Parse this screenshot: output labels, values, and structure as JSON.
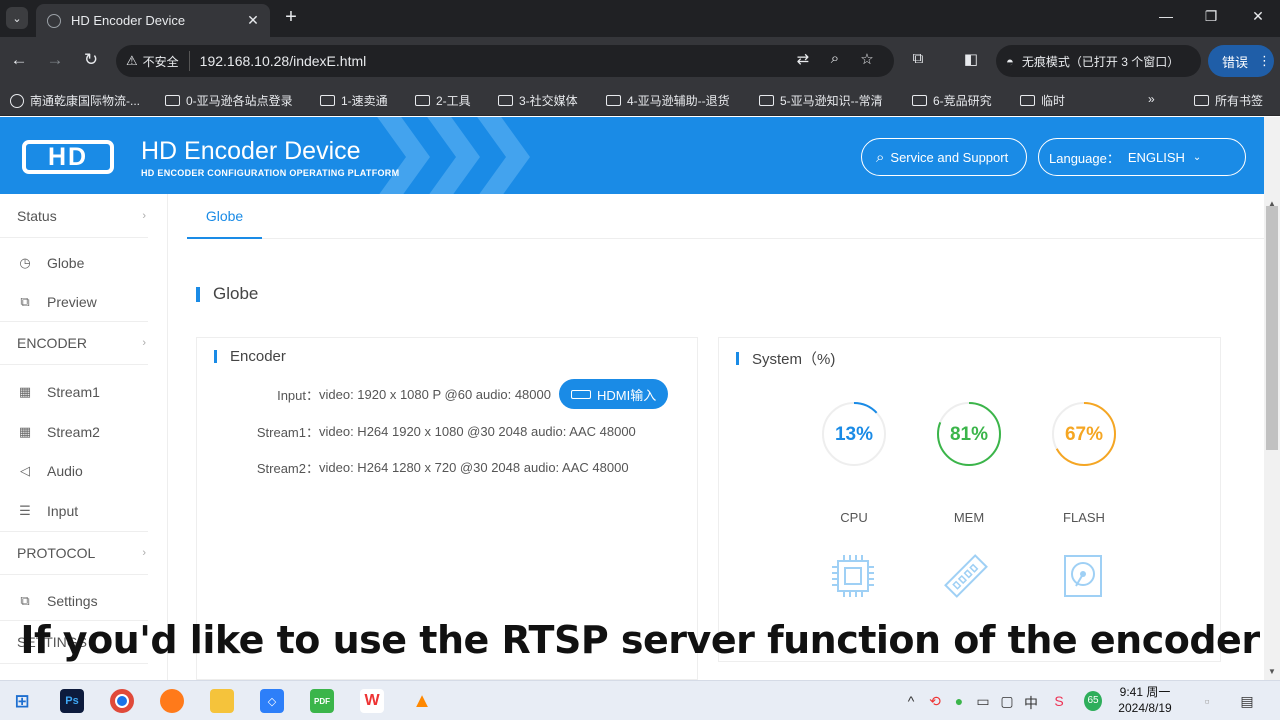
{
  "browser": {
    "tab_title": "HD Encoder Device",
    "insecure_label": "不安全",
    "url": "192.168.10.28/indexE.html",
    "incognito_label": "无痕模式（已打开 3 个窗口）",
    "error_label": "错误",
    "bookmarks": [
      "南通乾康国际物流-...",
      "0-亚马逊各站点登录",
      "1-速卖通",
      "2-工具",
      "3-社交媒体",
      "4-亚马逊辅助--退货",
      "5-亚马逊知识--常清",
      "6-竞品研究",
      "临时"
    ],
    "all_bookmarks": "所有书签"
  },
  "header": {
    "logo_text": "HD",
    "title": "HD Encoder Device",
    "subtitle": "HD ENCODER CONFIGURATION OPERATING PLATFORM",
    "service_label": "Service and Support",
    "language_label": "Language：",
    "language_value": "ENGLISH"
  },
  "sidebar": {
    "status": "Status",
    "globe": "Globe",
    "preview": "Preview",
    "encoder": "ENCODER",
    "stream1": "Stream1",
    "stream2": "Stream2",
    "audio": "Audio",
    "input": "Input",
    "protocol": "PROTOCOL",
    "settings": "Settings",
    "settings_section": "SETTINGS"
  },
  "main": {
    "tab_label": "Globe",
    "section_title": "Globe",
    "encoder_panel": {
      "title": "Encoder",
      "rows": [
        {
          "label": "Input：",
          "value": "video: 1920 x 1080 P @60 audio: 48000"
        },
        {
          "label": "Stream1：",
          "value": "video: H264 1920 x 1080 @30 2048 audio: AAC 48000"
        },
        {
          "label": "Stream2：",
          "value": "video: H264 1280 x 720 @30 2048 audio: AAC 48000"
        }
      ],
      "input_badge": "HDMI输入"
    },
    "system_panel": {
      "title": "System（%)",
      "gauges": [
        {
          "name": "CPU",
          "value": 13,
          "display": "13%",
          "color": "#1a8be6"
        },
        {
          "name": "MEM",
          "value": 81,
          "display": "81%",
          "color": "#3bb54a"
        },
        {
          "name": "FLASH",
          "value": 67,
          "display": "67%",
          "color": "#f5a623"
        }
      ]
    }
  },
  "caption": "If you'd like to use the RTSP server function of the encoder",
  "taskbar": {
    "time": "9:41 周一",
    "date": "2024/8/19",
    "input_method": "中"
  }
}
